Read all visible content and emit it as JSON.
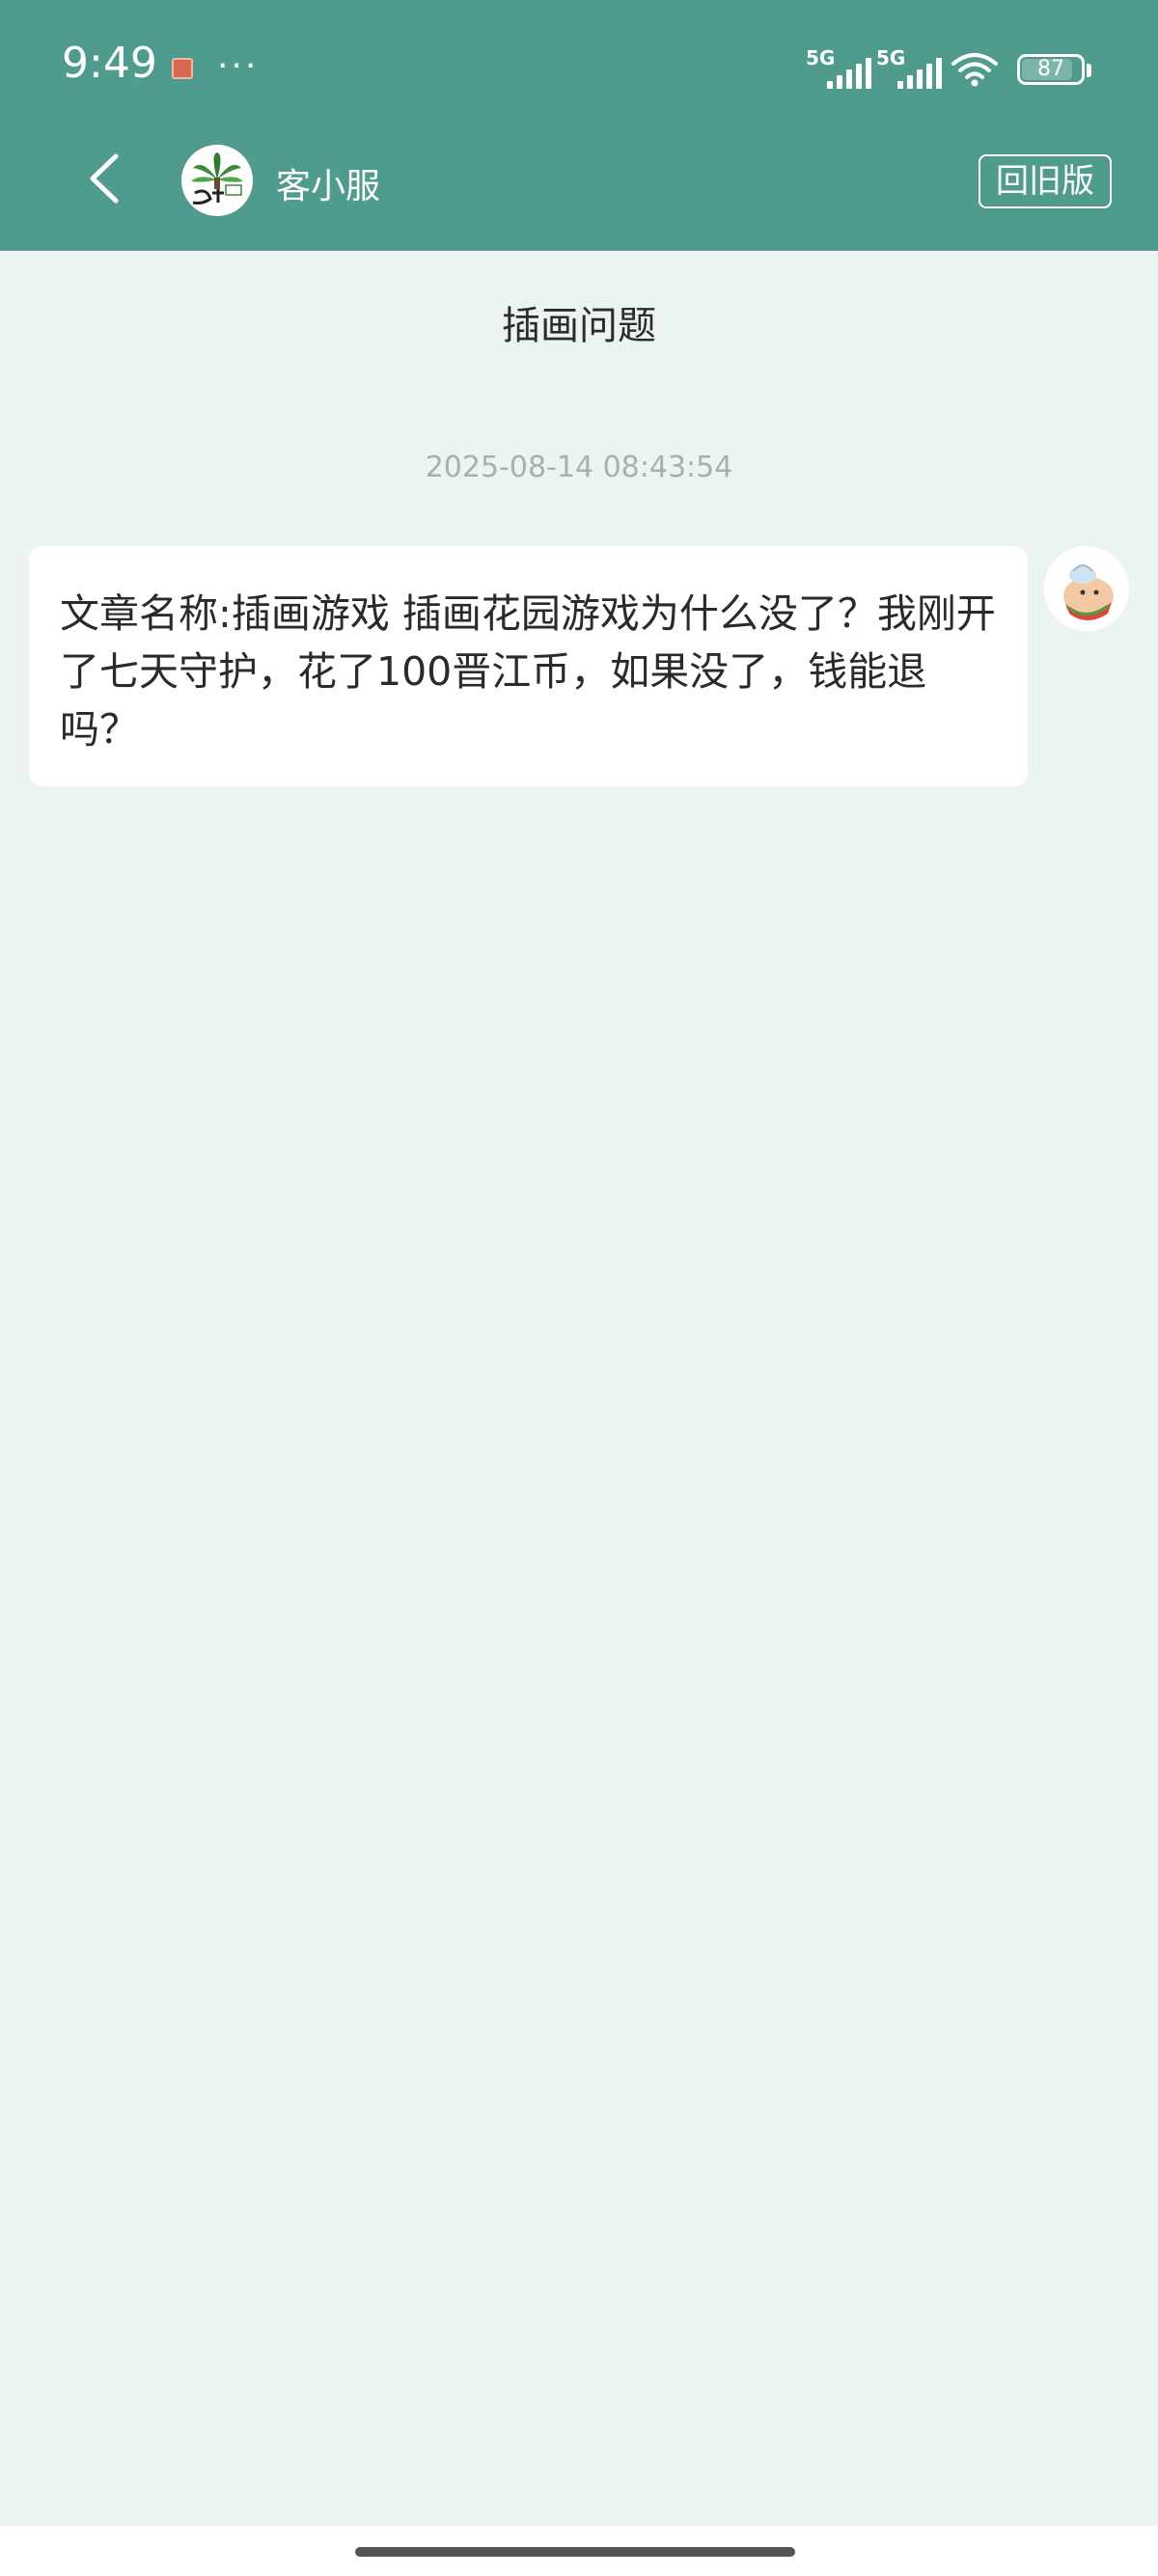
{
  "status_bar": {
    "time": "9:49",
    "network_1": "5G",
    "network_2": "5G",
    "battery": "87"
  },
  "header": {
    "title": "客小服",
    "old_version_label": "回旧版"
  },
  "page": {
    "title": "插画问题",
    "timestamp": "2025-08-14 08:43:54"
  },
  "message": {
    "text": "文章名称:插画游戏 插画花园游戏为什么没了？我刚开了七天守护，花了100晋江币，如果没了，钱能退吗？"
  },
  "colors": {
    "header_bg": "#4f9b8d",
    "page_bg": "#ecf4f2",
    "bubble_bg": "#ffffff"
  }
}
